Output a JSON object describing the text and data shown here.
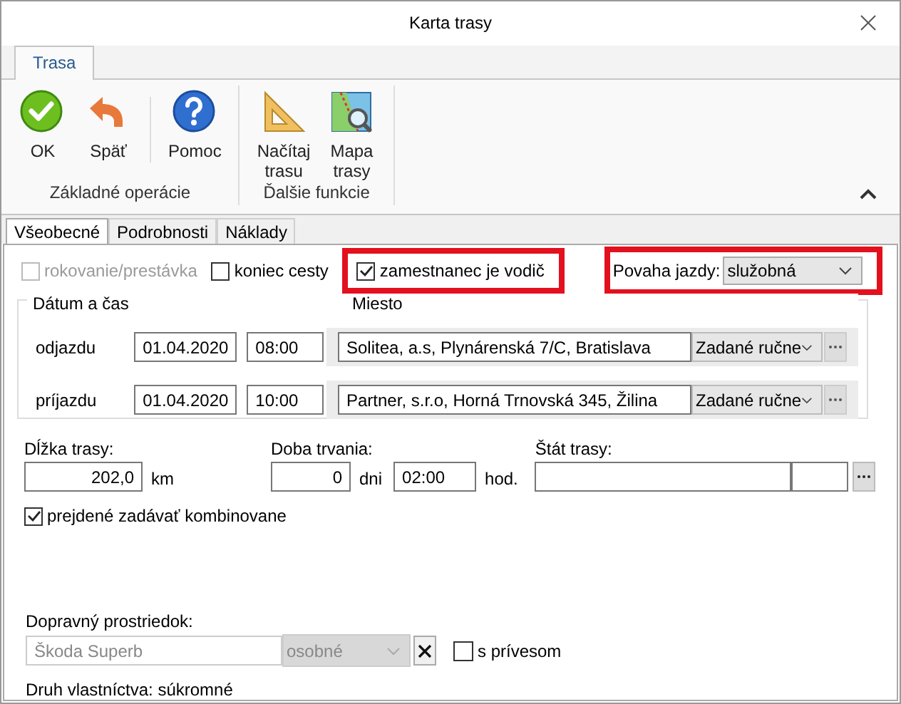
{
  "window": {
    "title": "Karta trasy"
  },
  "ribbon": {
    "tabs": [
      {
        "label": "Trasa"
      }
    ],
    "groups": [
      {
        "label": "Základné operácie",
        "buttons": [
          {
            "kind": "ok",
            "label": "OK",
            "divided": false
          },
          {
            "kind": "back",
            "label": "Späť",
            "divided": false
          },
          {
            "kind": "help",
            "label": "Pomoc",
            "divided": true
          }
        ]
      },
      {
        "label": "Ďalšie funkcie",
        "buttons": [
          {
            "kind": "ruler",
            "label": "Načítaj\ntrasu",
            "divided": false
          },
          {
            "kind": "map",
            "label": "Mapa\ntrasy",
            "divided": false
          }
        ]
      }
    ]
  },
  "tabs": [
    {
      "label": "Všeobecné",
      "selected": true
    },
    {
      "label": "Podrobnosti",
      "selected": false
    },
    {
      "label": "Náklady",
      "selected": false
    }
  ],
  "options": [
    {
      "label": "rokovanie/prestávka",
      "checked": false,
      "disabled": true,
      "highlighted": false
    },
    {
      "label": "koniec cesty",
      "checked": false,
      "disabled": false,
      "highlighted": false
    },
    {
      "label": "zamestnanec je vodič",
      "checked": true,
      "disabled": false,
      "highlighted": true
    }
  ],
  "trip_type": {
    "label": "Povaha jazdy:",
    "value": "služobná",
    "highlighted": true
  },
  "stops": {
    "headers": [
      "Dátum a čas",
      "Miesto"
    ],
    "rows": [
      {
        "label": "odjazdu",
        "date": "01.04.2020",
        "time": "08:00",
        "place": "Solitea, a.s, Plynárenská 7/C, Bratislava",
        "mode": "Zadané ručne"
      },
      {
        "label": "príjazdu",
        "date": "01.04.2020",
        "time": "10:00",
        "place": "Partner, s.r.o, Horná Trnovská 345, Žilina",
        "mode": "Zadané ručne"
      }
    ]
  },
  "length": {
    "label": "Dĺžka trasy:",
    "value": "202,0",
    "unit": "km"
  },
  "duration": {
    "label": "Doba trvania:",
    "days": "0",
    "days_unit": "dni",
    "time": "02:00",
    "unit": "hod."
  },
  "country": {
    "label": "Štát trasy:"
  },
  "combined": {
    "label": "prejdené zadávať kombinovane",
    "checked": true
  },
  "vehicle": {
    "label": "Dopravný prostriedok:",
    "name": "Škoda Superb",
    "type": "osobné",
    "disabled": true,
    "trailer": {
      "label": "s prívesom",
      "checked": false
    },
    "ownership": "Druh vlastníctva: súkromné"
  }
}
